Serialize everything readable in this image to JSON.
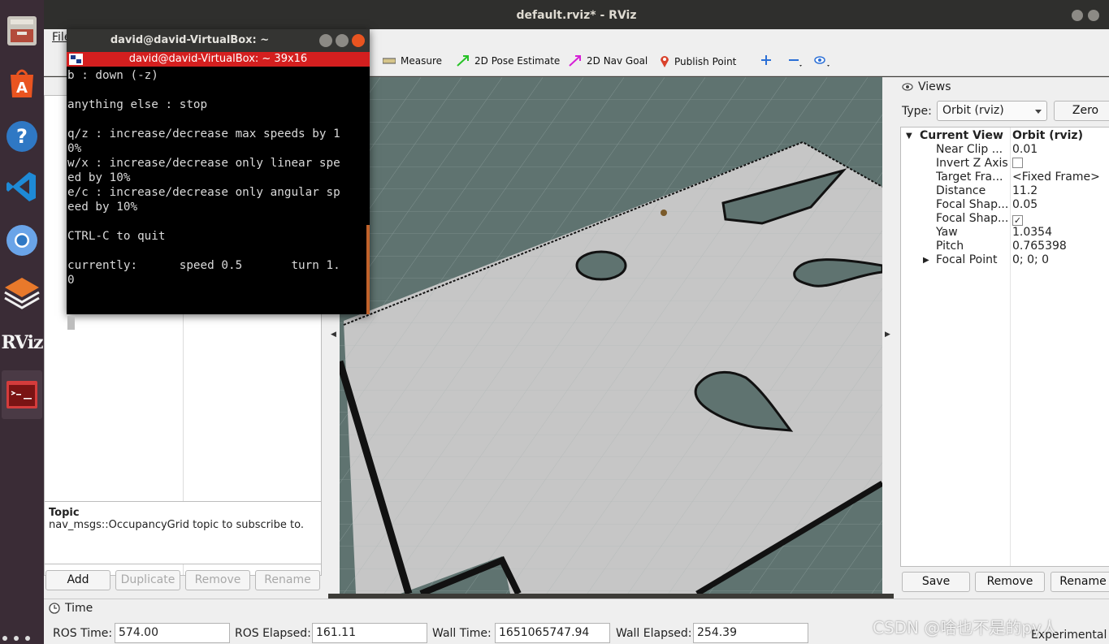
{
  "window": {
    "title": "default.rviz* - RViz"
  },
  "menubar": {
    "first_menu": "File"
  },
  "toolbar": {
    "measure": "Measure",
    "pose_estimate": "2D Pose Estimate",
    "nav_goal": "2D Nav Goal",
    "publish_point": "Publish Point"
  },
  "displays": {
    "description_title": "Topic",
    "description_text": "nav_msgs::OccupancyGrid topic to subscribe to.",
    "buttons": {
      "add": "Add",
      "duplicate": "Duplicate",
      "remove": "Remove",
      "rename": "Rename"
    }
  },
  "views": {
    "title": "Views",
    "type_label": "Type:",
    "type_value": "Orbit (rviz)",
    "zero_label": "Zero",
    "current_view": {
      "label": "Current View",
      "value": "Orbit (rviz)"
    },
    "properties": [
      {
        "key": "Near Clip ...",
        "value": "0.01"
      },
      {
        "key": "Invert Z Axis",
        "value": ""
      },
      {
        "key": "Target Fra...",
        "value": "<Fixed Frame>"
      },
      {
        "key": "Distance",
        "value": "11.2"
      },
      {
        "key": "Focal Shap...",
        "value": "0.05"
      },
      {
        "key": "Focal Shap...",
        "value": "✓"
      },
      {
        "key": "Yaw",
        "value": "1.0354"
      },
      {
        "key": "Pitch",
        "value": "0.765398"
      },
      {
        "key": "Focal Point",
        "value": "0; 0; 0"
      }
    ],
    "buttons": {
      "save": "Save",
      "remove": "Remove",
      "rename": "Rename"
    }
  },
  "time": {
    "title": "Time",
    "ros_time_label": "ROS Time:",
    "ros_time": "574.00",
    "ros_elapsed_label": "ROS Elapsed:",
    "ros_elapsed": "161.11",
    "wall_time_label": "Wall Time:",
    "wall_time": "1651065747.94",
    "wall_elapsed_label": "Wall Elapsed:",
    "wall_elapsed": "254.39",
    "experimental": "Experimental"
  },
  "terminal": {
    "title": "david@david-VirtualBox: ~",
    "tab_title": "david@david-VirtualBox: ~ 39x16",
    "lines": "b : down (-z)\n\nanything else : stop\n\nq/z : increase/decrease max speeds by 1\n0%\nw/x : increase/decrease only linear spe\ned by 10%\ne/c : increase/decrease only angular sp\need by 10%\n\nCTRL-C to quit\n\ncurrently:      speed 0.5       turn 1.\n0"
  },
  "dock": {
    "icons": [
      "files-icon",
      "software-center-icon",
      "help-icon",
      "vscode-icon",
      "chromium-icon",
      "layers-app-icon",
      "rviz-icon",
      "terminal-icon"
    ],
    "rviz_label": "RViz"
  },
  "watermark": "CSDN @啥也不是的py人",
  "colors": {
    "terminal_tab": "#d41f1f",
    "map_free": "#c6c6c6",
    "map_bg": "#5f7370",
    "dock": "#3a2c36"
  }
}
